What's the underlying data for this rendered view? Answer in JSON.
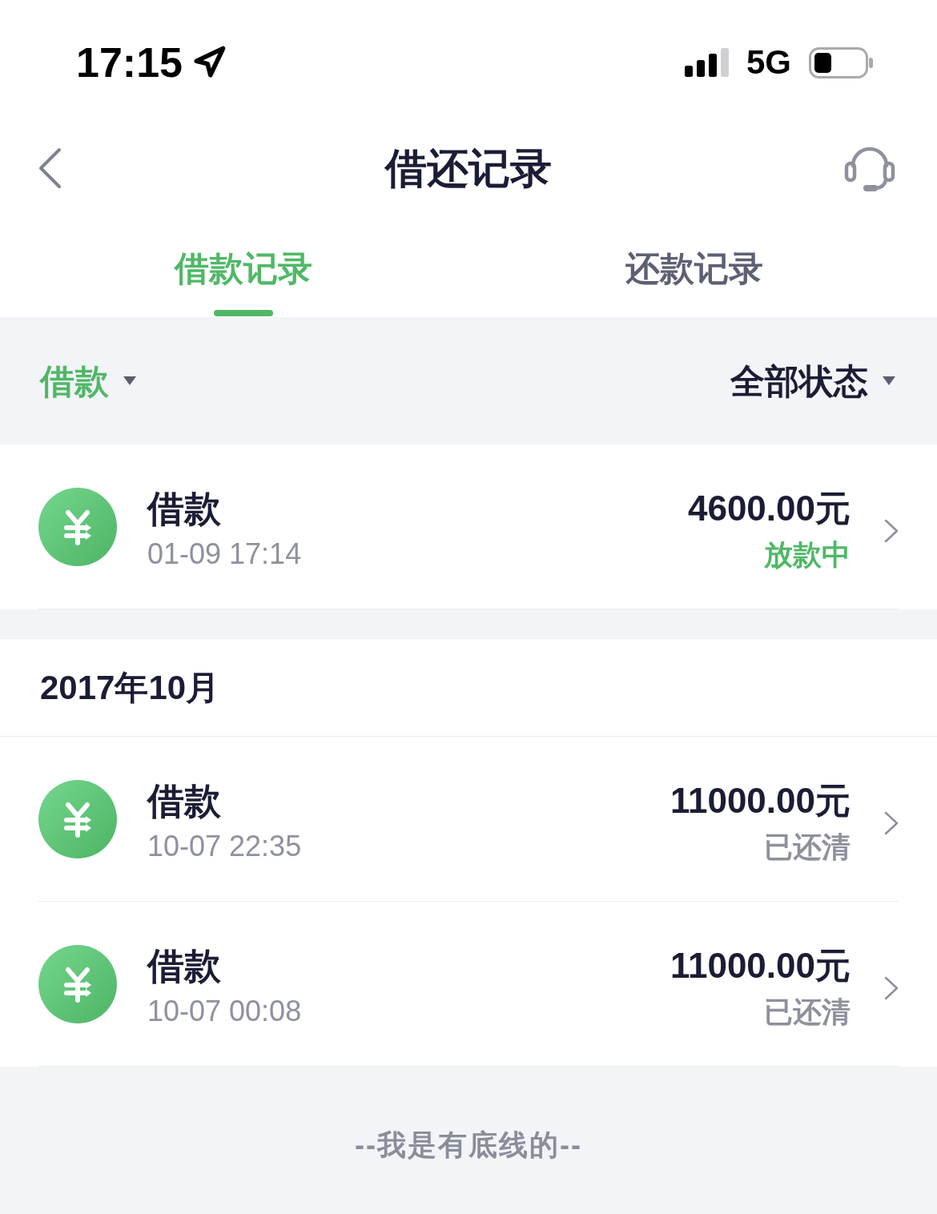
{
  "status_bar": {
    "time": "17:15",
    "network": "5G"
  },
  "nav_bar": {
    "title": "借还记录"
  },
  "tabs": [
    {
      "label": "借款记录",
      "selected": true
    },
    {
      "label": "还款记录",
      "selected": false
    }
  ],
  "filters": [
    {
      "label": "借款",
      "active": true
    },
    {
      "label": "全部状态",
      "active": false
    }
  ],
  "sections": [
    {
      "records": [
        {
          "title": "借款",
          "time": "01-09 17:14",
          "amount": "4600.00元",
          "status": {
            "text": "放款中",
            "color": "#4fb866"
          }
        }
      ]
    },
    {
      "heading": "2017年10月",
      "records": [
        {
          "title": "借款",
          "time": "10-07 22:35",
          "amount": "11000.00元",
          "status": {
            "text": "已还清",
            "color": "#8e909c"
          }
        },
        {
          "title": "借款",
          "time": "10-07 00:08",
          "amount": "11000.00元",
          "status": {
            "text": "已还清",
            "color": "#8e909c"
          }
        }
      ]
    }
  ],
  "footer": "--我是有底线的--"
}
